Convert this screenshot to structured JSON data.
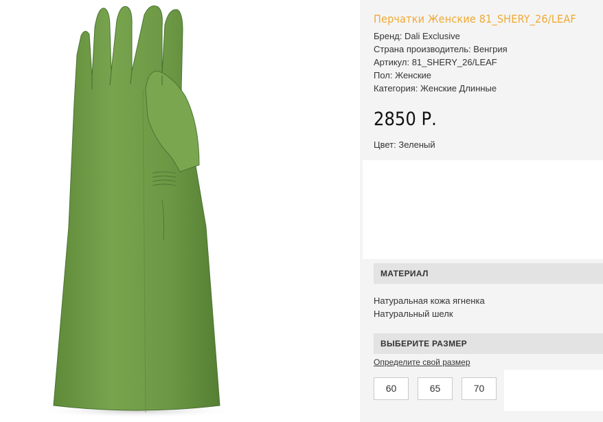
{
  "product": {
    "title": "Перчатки Женские 81_SHERY_26/LEAF",
    "brand": "Бренд: Dali Exclusive",
    "country": "Страна производитель: Венгрия",
    "sku": "Артикул: 81_SHERY_26/LEAF",
    "gender": "Пол: Женские",
    "category": "Категория: Женские Длинные",
    "price": "2850 Р.",
    "color": "Цвет: Зеленый",
    "image_icon": "green-glove-image"
  },
  "material": {
    "header": "МАТЕРИАЛ",
    "lines": [
      "Натуральная кожа ягненка",
      "Натуральный шелк"
    ]
  },
  "size": {
    "header": "ВЫБЕРИТЕ РАЗМЕР",
    "link": "Определите свой размер",
    "options": [
      "60",
      "65",
      "70"
    ]
  },
  "colors": {
    "title": "#f0a932",
    "glove": "#6e9a46",
    "panel": "#f4f4f4",
    "section_header": "#e3e3e3"
  }
}
